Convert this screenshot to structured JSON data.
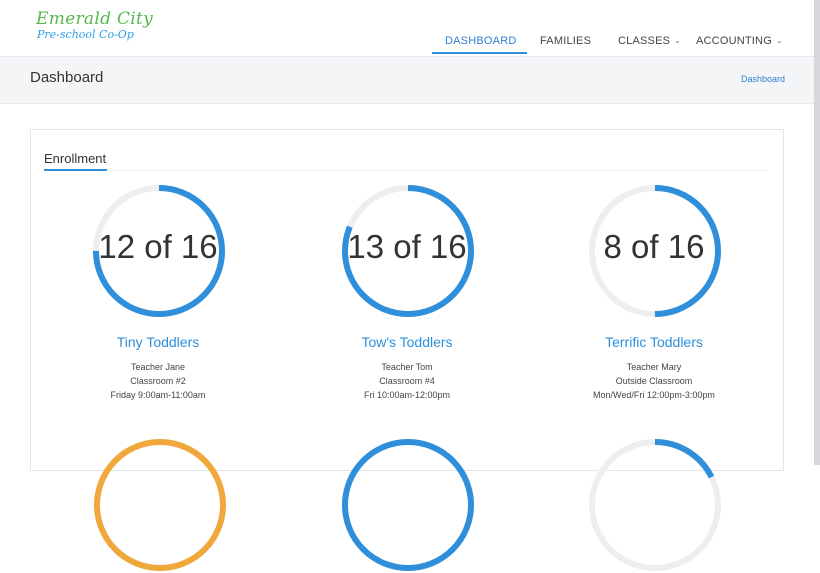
{
  "brand": {
    "title": "Emerald City",
    "subtitle": "Pre-school Co-Op"
  },
  "nav": [
    {
      "label": "DASHBOARD",
      "active": true,
      "has_dropdown": false
    },
    {
      "label": "FAMILIES",
      "active": false,
      "has_dropdown": false
    },
    {
      "label": "CLASSES",
      "active": false,
      "has_dropdown": true
    },
    {
      "label": "ACCOUNTING",
      "active": false,
      "has_dropdown": true
    }
  ],
  "page": {
    "title": "Dashboard",
    "breadcrumb": "Dashboard"
  },
  "enrollment": {
    "title": "Enrollment",
    "classes": [
      {
        "enrolled_text": "12 of 16",
        "enrolled": 12,
        "capacity": 16,
        "name": "Tiny Toddlers",
        "teacher": "Teacher Jane",
        "room": "Classroom #2",
        "schedule": "Friday 9:00am-11:00am",
        "color": "#2f8fdb"
      },
      {
        "enrolled_text": "13 of 16",
        "enrolled": 13,
        "capacity": 16,
        "name": "Tow's Toddlers",
        "teacher": "Teacher Tom",
        "room": "Classroom #4",
        "schedule": "Fri 10:00am-12:00pm",
        "color": "#2f8fdb"
      },
      {
        "enrolled_text": "8 of 16",
        "enrolled": 8,
        "capacity": 16,
        "name": "Terrific Toddlers",
        "teacher": "Teacher Mary",
        "room": "Outside Classroom",
        "schedule": "Mon/Wed/Fri 12:00pm-3:00pm",
        "color": "#2f8fdb"
      }
    ],
    "partial_ring_colors": [
      "#f0a73c",
      "#2f8fdb",
      "#2f8fdb"
    ]
  },
  "colors": {
    "accent": "#2f8fdb",
    "brand_green": "#54b94b",
    "ring_track": "#eeeeee"
  }
}
